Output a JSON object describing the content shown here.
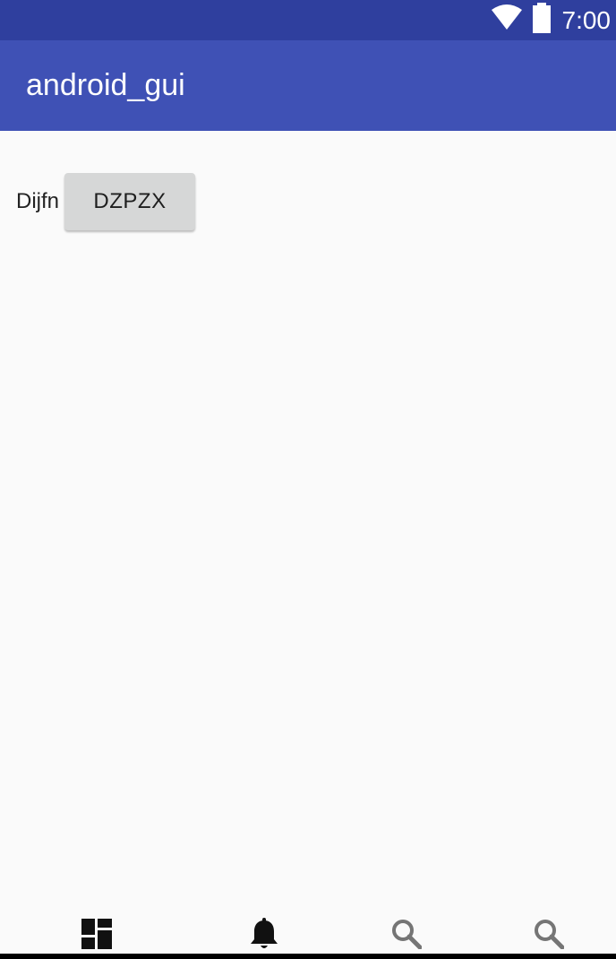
{
  "status_bar": {
    "time": "7:00",
    "wifi_icon": "wifi-icon",
    "battery_icon": "battery-icon",
    "background_color": "#2f3f9e"
  },
  "app_bar": {
    "title": "android_gui",
    "background_color": "#3f51b5"
  },
  "content": {
    "label": "Dijfn",
    "button_label": "DZPZX"
  },
  "bottom_nav": {
    "items": [
      {
        "icon": "dashboard-icon"
      },
      {
        "icon": "notifications-icon"
      },
      {
        "icon": "search-icon"
      },
      {
        "icon": "search-icon"
      }
    ]
  }
}
